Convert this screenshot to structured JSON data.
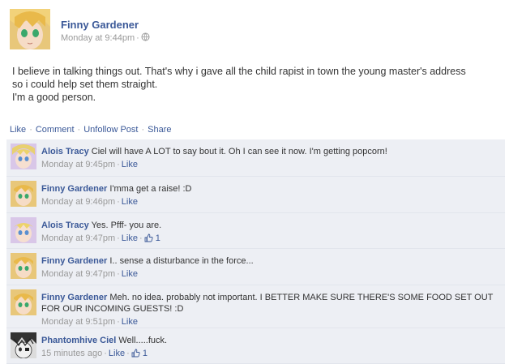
{
  "post": {
    "author": "Finny Gardener",
    "time": "Monday at 9:44pm",
    "lines": [
      "I believe in talking things out. That's why i gave all the child rapist in town the young master's address",
      "so i could help set them straight.",
      "I'm a good person."
    ]
  },
  "actions": {
    "like": "Like",
    "comment": "Comment",
    "unfollow": "Unfollow Post",
    "share": "Share"
  },
  "comments": [
    {
      "author": "Alois Tracy",
      "text": "Ciel will have A LOT to say bout it. Oh I can see it now. I'm getting popcorn!",
      "text2": "",
      "time": "Monday at 9:45pm",
      "like": "Like",
      "likes": ""
    },
    {
      "author": "Finny Gardener",
      "text": "I'mma get a raise! :D",
      "text2": "",
      "time": "Monday at 9:46pm",
      "like": "Like",
      "likes": ""
    },
    {
      "author": "Alois Tracy",
      "text": "Yes. Pfff- you are.",
      "text2": "",
      "time": "Monday at 9:47pm",
      "like": "Like",
      "likes": "1"
    },
    {
      "author": "Finny Gardener",
      "text": "I.. sense a disturbance in the force...",
      "text2": "",
      "time": "Monday at 9:47pm",
      "like": "Like",
      "likes": ""
    },
    {
      "author": "Finny Gardener",
      "text": "Meh. no idea. probably not important. I BETTER MAKE SURE THERE'S SOME FOOD SET OUT",
      "text2": "FOR OUR INCOMING GUESTS! :D",
      "time": "Monday at 9:51pm",
      "like": "Like",
      "likes": ""
    },
    {
      "author": "Phantomhive Ciel",
      "text": "Well.....fuck.",
      "text2": "",
      "time": "15 minutes ago",
      "like": "Like",
      "likes": "1"
    }
  ],
  "colors": {
    "link": "#3b5998",
    "comment_bg": "#edeff4",
    "meta": "#999999"
  },
  "icons": {
    "privacy": "globe-icon",
    "like_count": "thumbs-up-icon",
    "avatar": "anime-avatar"
  }
}
